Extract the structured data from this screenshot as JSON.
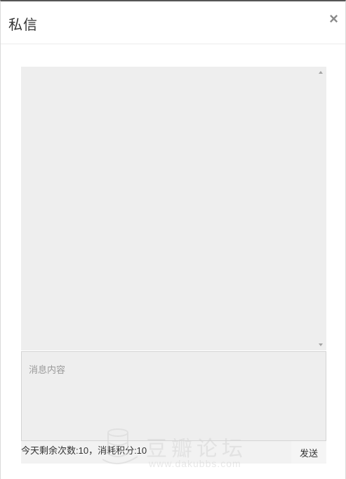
{
  "dialog": {
    "title": "私信",
    "close_label": "×"
  },
  "message_list": {
    "scroll_up_icon": "caret-up-icon",
    "scroll_down_icon": "caret-down-icon"
  },
  "composer": {
    "value": "",
    "placeholder": "消息内容"
  },
  "footer": {
    "quota_text": "今天剩余次数:10，消耗积分:10",
    "send_label": "发送"
  },
  "watermark": {
    "text": "豆瓣论坛",
    "url": "www.dakubbs.com",
    "icon": "cylinder-logo-icon"
  }
}
